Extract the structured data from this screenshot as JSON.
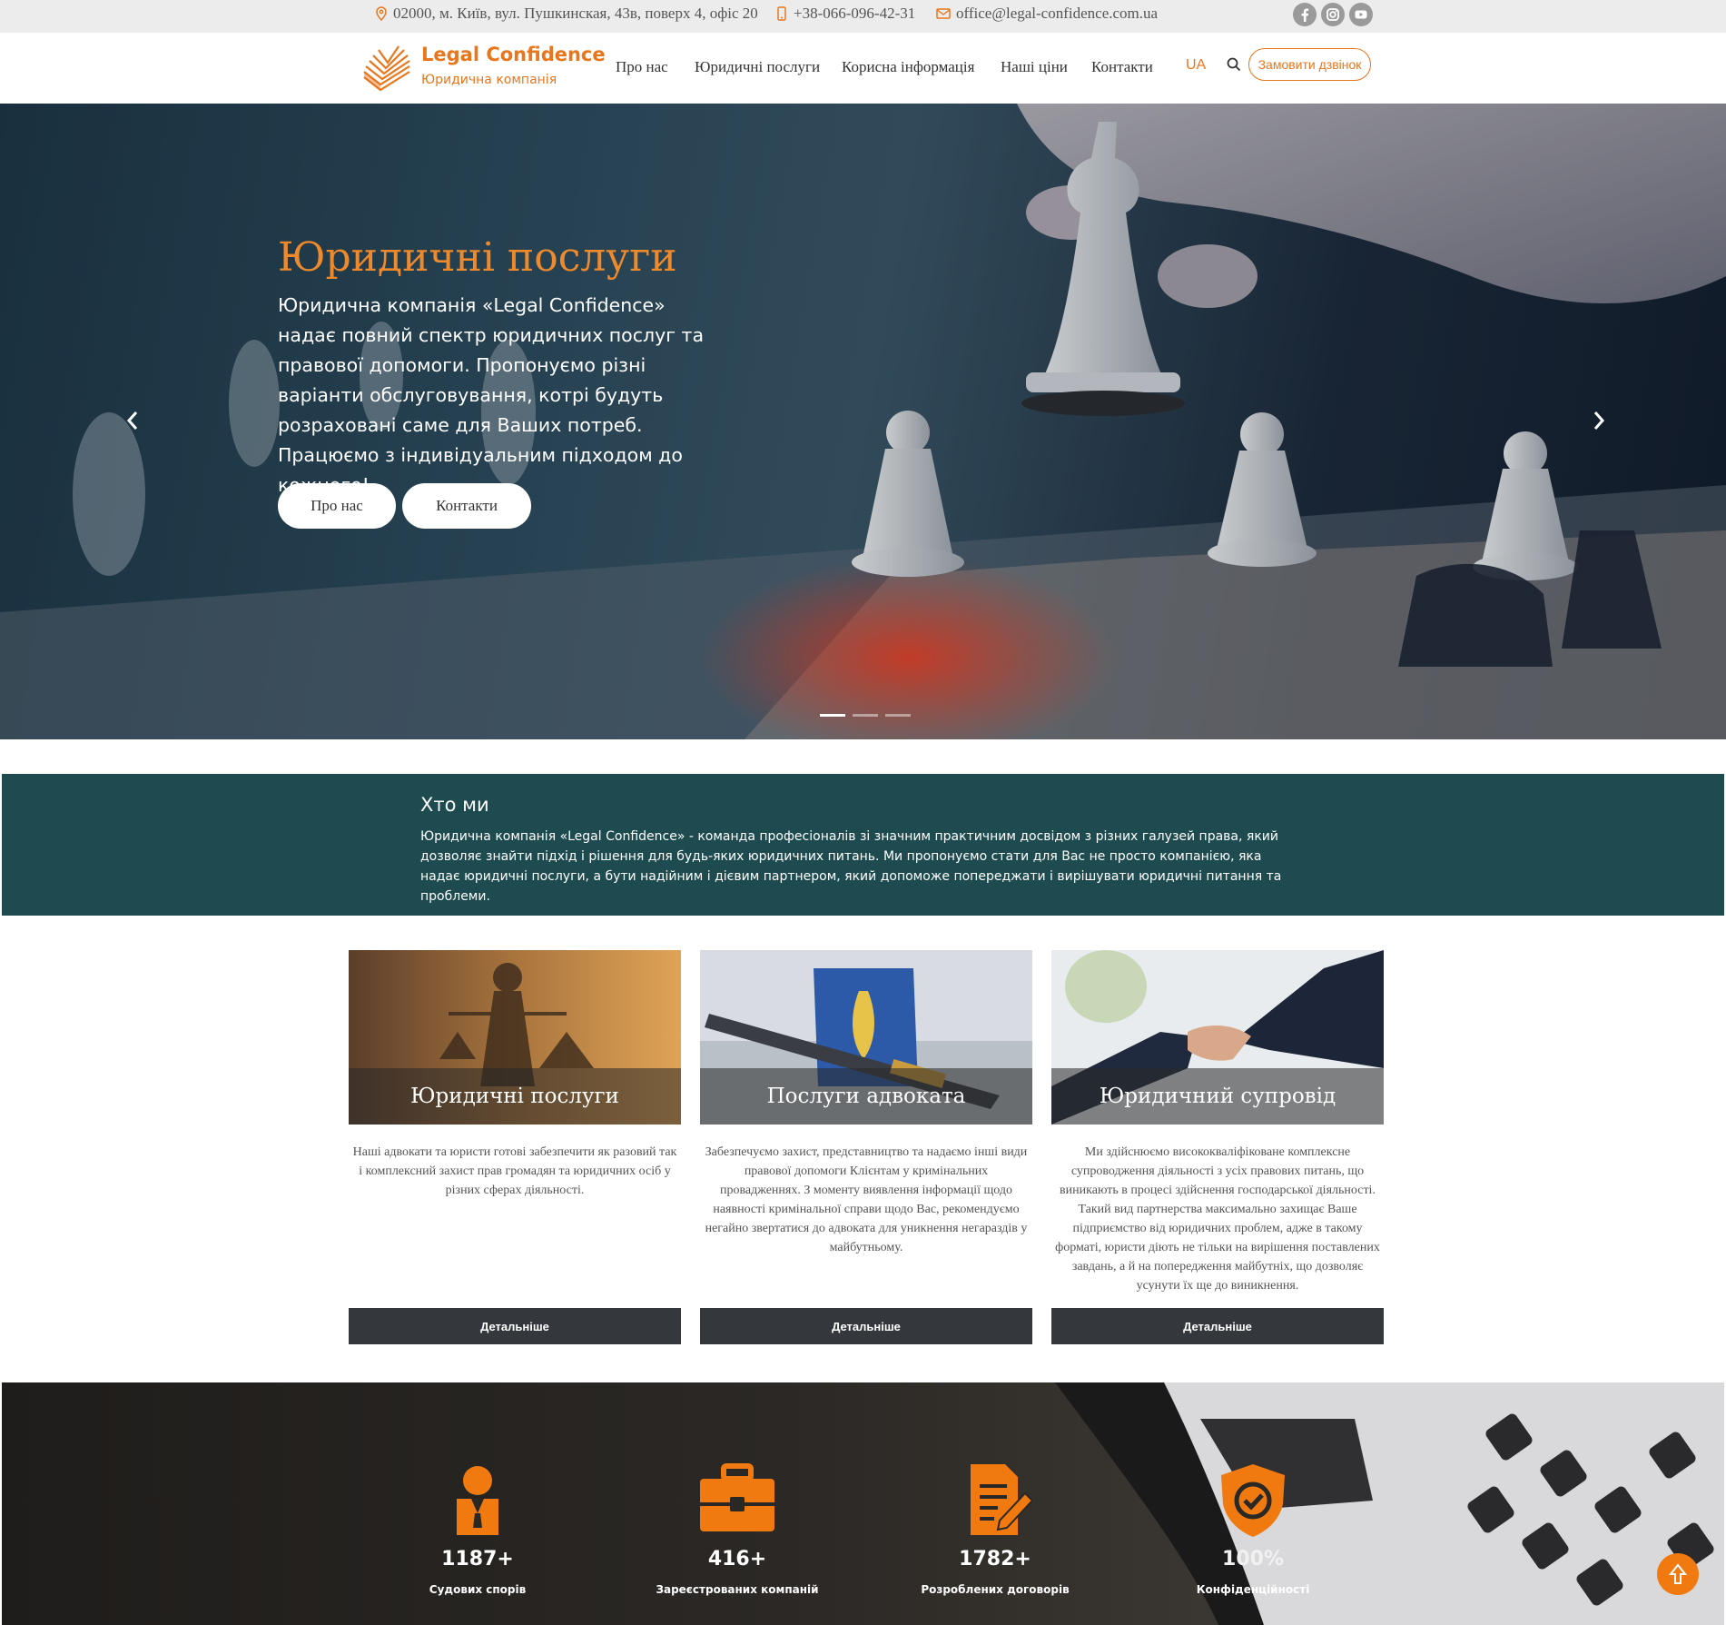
{
  "topbar": {
    "address": "02000, м. Київ, вул. Пушкинская, 43в, поверх 4, офіс 20",
    "phone": "+38-066-096-42-31",
    "email": "office@legal-confidence.com.ua",
    "social_icons": [
      "facebook-icon",
      "instagram-icon",
      "youtube-icon"
    ]
  },
  "header": {
    "logo_title": "Legal Confidence",
    "logo_subtitle": "Юридична компанія",
    "nav": [
      "Про нас",
      "Юридичні послуги",
      "Корисна інформація",
      "Наші ціни",
      "Контакти"
    ],
    "lang": "UA",
    "call_button": "Замовити дзвінок"
  },
  "hero": {
    "title": "Юридичні послуги",
    "text": "Юридична компанія «Legal Confidence» надає повний спектр юридичних послуг та правової допомоги. Пропонуємо різні варіанти обслуговування, котрі будуть розраховані саме для Ваших потреб. Працюємо з індивідуальним підходом до кожного!",
    "button_about": "Про нас",
    "button_contacts": "Контакти",
    "slides_total": 3,
    "active_slide": 1
  },
  "who": {
    "title": "Хто ми",
    "text": "Юридична компанія «Legal Confidence» - команда професіоналів зі значним практичним досвідом з різних галузей права, який дозволяє знайти підхід і рішення для будь-яких юридичних питань. Ми пропонуємо стати для Вас не просто компанією, яка надає юридичні послуги, а бути надійним і дієвим партнером, який допоможе попереджати і вирішувати юридичні питання та проблеми."
  },
  "services": [
    {
      "title": "Юридичні послуги",
      "text": "Наші адвокати та юристи готові забезпечити як разовий так і комплексний захист прав громадян та юридичних осіб у різних сферах діяльності.",
      "button": "Детальніше"
    },
    {
      "title": "Послуги адвоката",
      "text": "Забезпечуємо захист, представництво та надаємо інші види правової допомоги Клієнтам у кримінальних провадженнях. З моменту виявлення інформації щодо наявності кримінальної справи щодо Вас, рекомендуємо негайно звертатися до адвоката для уникнення негараздів у майбутньому.",
      "button": "Детальніше"
    },
    {
      "title": "Юридичний супровід",
      "text": "Ми здійснюємо висококваліфіковане комплексне супроводження діяльності з усіх правових питань, що виникають в процесі здійснення господарської діяльності. Такий вид партнерства максимально захищає Ваше підприємство від юридичних проблем, адже в такому форматі, юристи діють не тільки на вирішення поставлених завдань, а й на попередження майбутніх, що дозволяє усунути їх ще до виникнення.",
      "button": "Детальніше"
    }
  ],
  "stats": [
    {
      "value": "1187+",
      "label": "Судових спорів",
      "icon": "lawyer-icon"
    },
    {
      "value": "416+",
      "label": "Зареєстрованих компаній",
      "icon": "briefcase-icon"
    },
    {
      "value": "1782+",
      "label": "Розроблених договорів",
      "icon": "document-pen-icon"
    },
    {
      "value": "100%",
      "label": "Конфіденційності",
      "icon": "shield-check-icon"
    }
  ],
  "colors": {
    "accent": "#e8761d",
    "who_bg": "#1e4b4f",
    "button_dark": "#34383d"
  }
}
